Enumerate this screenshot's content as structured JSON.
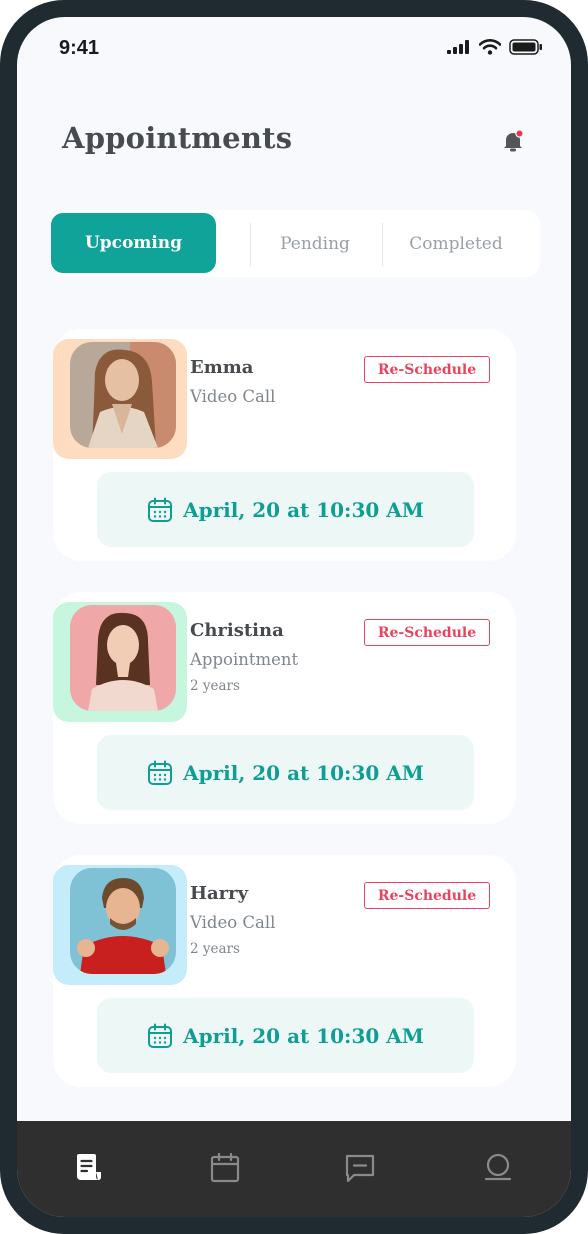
{
  "status": {
    "time": "9:41"
  },
  "header": {
    "title": "Appointments"
  },
  "tabs": [
    {
      "label": "Upcoming"
    },
    {
      "label": "Pending"
    },
    {
      "label": "Completed"
    }
  ],
  "appointments": [
    {
      "name": "Emma",
      "type": "Video Call",
      "years": "",
      "action": "Re-Schedule",
      "date": "April, 20 at 10:30 AM",
      "accent": "#fedcbf"
    },
    {
      "name": "Christina",
      "type": "Appointment",
      "years": "2 years",
      "action": "Re-Schedule",
      "date": "April, 20 at 10:30 AM",
      "accent": "#c6f6dd"
    },
    {
      "name": "Harry",
      "type": "Video Call",
      "years": "2 years",
      "action": "Re-Schedule",
      "date": "April, 20 at 10:30 AM",
      "accent": "#c5ecfb"
    }
  ],
  "nav": [
    "document-icon",
    "calendar-icon",
    "message-icon",
    "profile-icon"
  ],
  "colors": {
    "primary": "#0fa39a",
    "danger": "#e8445e",
    "nav_bg": "#2f2f2f"
  }
}
